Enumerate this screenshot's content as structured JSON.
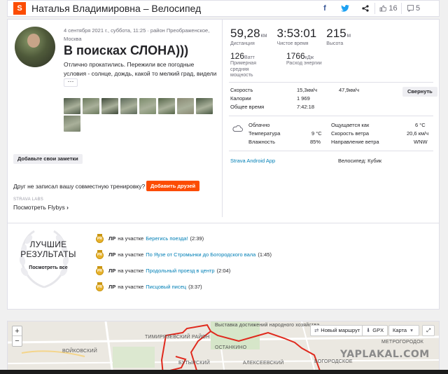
{
  "header": {
    "logo_letter": "S",
    "title": "Наталья Владимировна – Велосипед",
    "share_facebook": "f",
    "share_twitter": "t",
    "share_more": "<",
    "kudos_count": "16",
    "comments_count": "5"
  },
  "activity": {
    "meta": "4 сентября 2021 г., суббота, 11:25 · район Преображенское, Москва",
    "title": "В поисках СЛОНА)))",
    "description": "Отлично прокатились. Пережили все погодные условия - солнце, дождь, какой то мелкий град, видели",
    "more_label": "···",
    "thumb_colors": [
      "#4d5a48",
      "#6b7a5d",
      "#3f4a3a",
      "#5d6a5a",
      "#7c8c6c",
      "#566649",
      "#8a8a74",
      "#4a5a44",
      "#76806a"
    ],
    "add_notes_label": "Добавьте свои заметки",
    "friend_question": "Друг не записал вашу совместную тренировку?",
    "add_friends_label": "Добавить друзей",
    "labs_label": "STRAVA LABS",
    "flyby_label": "Посмотреть Flybys",
    "flyby_chevron": "›"
  },
  "stats": {
    "distance": "59,28",
    "distance_unit": "км",
    "distance_label": "Дистанция",
    "moving_time": "3:53:01",
    "moving_time_label": "Чистое время",
    "elevation": "215",
    "elevation_unit": "м",
    "elevation_label": "Высота",
    "power": "126",
    "power_unit": "Ватт",
    "power_label": "Примерная средняя мощность",
    "energy": "1766",
    "energy_unit": "кДж",
    "energy_label": "Расход энергии"
  },
  "detail_table": {
    "rows": [
      {
        "label": "Скорость",
        "avg": "15,3км/ч",
        "max": "47,9км/ч"
      },
      {
        "label": "Калории",
        "avg": "1 969",
        "max": ""
      },
      {
        "label": "Общее время",
        "avg": "7:42:18",
        "max": ""
      }
    ],
    "collapse_label": "Свернуть"
  },
  "weather": {
    "left": [
      {
        "label": "Облачно",
        "value": ""
      },
      {
        "label": "Температура",
        "value": "9 °C"
      },
      {
        "label": "Влажность",
        "value": "85%"
      }
    ],
    "right": [
      {
        "label": "Ощущается как",
        "value": "6 °C"
      },
      {
        "label": "Скорость ветра",
        "value": "20,6 км/ч"
      },
      {
        "label": "Направление ветра",
        "value": "WNW"
      }
    ]
  },
  "device": {
    "app": "Strava Android App",
    "bike": "Велосипед: Кубик"
  },
  "achievements": {
    "badge_title": "ЛУЧШИЕ РЕЗУЛЬТАТЫ",
    "badge_link": "Посмотреть все",
    "segments": [
      {
        "medal": "PR",
        "pr": "ЛР",
        "prefix": "на участке",
        "name": "Берегись поезда!",
        "time": "(2:39)"
      },
      {
        "medal": "PR",
        "pr": "ЛР",
        "prefix": "на участке",
        "name": "По Яузе от Стромынки до Богородского вала",
        "time": "(1:45)"
      },
      {
        "medal": "PR",
        "pr": "ЛР",
        "prefix": "на участке",
        "name": "Продольный проезд в центр",
        "time": "(2:04)"
      },
      {
        "medal": "PR",
        "pr": "ЛР",
        "prefix": "на участке",
        "name": "Писцовый писец",
        "time": "(3:37)"
      }
    ]
  },
  "map": {
    "zoom_in": "+",
    "zoom_out": "−",
    "new_route": "Новый маршрут",
    "gpx": "GPX",
    "map_type": "Карта",
    "fullscreen": "⤢",
    "labels": {
      "timiryazevsky": "ТИМИРЯЗЕВСКИЙ РАЙОН",
      "voikovsky": "ВОЙКОВСКИЙ",
      "vdnh": "Выставка достижений народного хозяйства",
      "ostankino": "ОСТАНКИНО",
      "alekseevsky": "АЛЕКСЕЕВСКИЙ",
      "butyrsky": "БУТЫРСКИЙ",
      "metrogorodok": "МЕТРОГОРОДОК",
      "bogorodskoe": "БОГОРОДСКОЕ"
    },
    "watermark": "YAPLAKAL.COM",
    "route_color": "#e0291d"
  }
}
